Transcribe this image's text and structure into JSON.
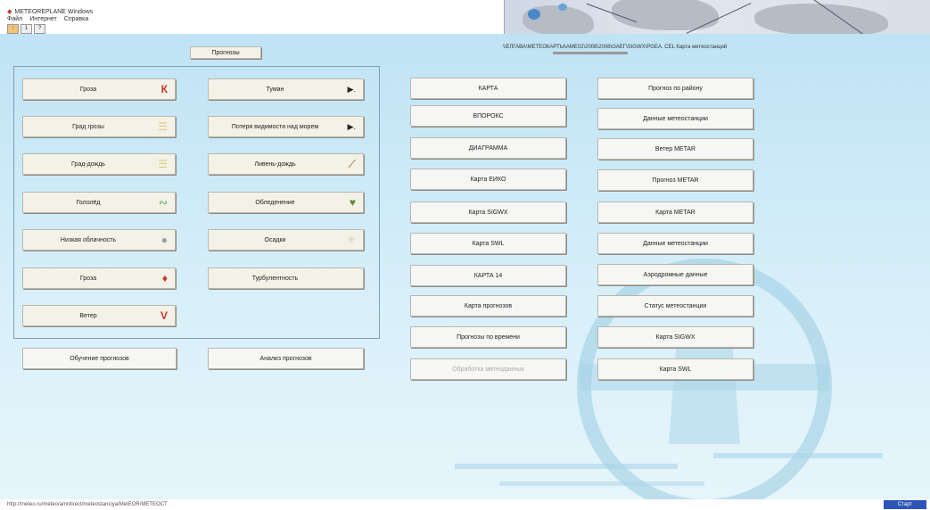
{
  "window": {
    "title": "METEOREPLANE Windows",
    "menu": [
      "Файл",
      "Интернет",
      "Справка"
    ],
    "toolbar": [
      "↑",
      "1",
      "?"
    ]
  },
  "header": {
    "tab_label": "Прогнозы",
    "path_text": "\\\\ЕЛГАВА\\МЕТЕОКАРТЫ\\АМЕ02\\2008\\2008\\ОАЕГ\\SIGWX\\PGEA. CEL Карта метеостанций"
  },
  "left_panel": {
    "buttons": [
      {
        "label": "Гроза",
        "icon": "lightning-flag-icon",
        "glyph": "К",
        "color": "#c0392b"
      },
      {
        "label": "Туман",
        "icon": "fog-icon",
        "glyph": "▶.",
        "color": "#222"
      },
      {
        "label": "Град грозы",
        "icon": "stripes-icon",
        "glyph": "☰",
        "color": "#d9cc80"
      },
      {
        "label": "Потеря видимости над морем",
        "icon": "visibility-arrow-icon",
        "glyph": "▶.",
        "color": "#222"
      },
      {
        "label": "Град-дождь",
        "icon": "stripes-icon",
        "glyph": "☰",
        "color": "#d9cc80"
      },
      {
        "label": "Ливень-дождь",
        "icon": "pen-icon",
        "glyph": "⟋",
        "color": "#7a4a2a"
      },
      {
        "label": "Гололёд",
        "icon": "icing-icon",
        "glyph": "∾",
        "color": "#55aa55"
      },
      {
        "label": "Обледенение",
        "icon": "leaf-icon",
        "glyph": "♥",
        "color": "#5b8f3c"
      },
      {
        "label": "Низкая облачность",
        "icon": "cloud-icon",
        "glyph": "●",
        "color": "#9aa0a6"
      },
      {
        "label": "Осадки",
        "icon": "snowflake-icon",
        "glyph": "✳",
        "color": "#d8d0c4"
      },
      {
        "label": "Гроза",
        "icon": "red-drop-icon",
        "glyph": "♦",
        "color": "#c0392b"
      },
      {
        "label": "Турбулентность",
        "icon": "",
        "glyph": "",
        "color": ""
      },
      {
        "label": "Ветер",
        "icon": "wind-v-icon",
        "glyph": "V",
        "color": "#c0392b"
      }
    ],
    "bottom_buttons": [
      "Обучение прогнозов",
      "Анализ прогнозов"
    ]
  },
  "center_buttons": [
    {
      "label": "КАРТА",
      "disabled": false
    },
    {
      "label": "ВПОРОКС",
      "disabled": false
    },
    {
      "label": "ДИАГРАММА",
      "disabled": false
    },
    {
      "label": "Карта ЕИКО",
      "disabled": false
    },
    {
      "label": "Карта SIGWX",
      "disabled": false
    },
    {
      "label": "Карта SWL",
      "disabled": false
    },
    {
      "label": "КАРТА 14",
      "disabled": false
    },
    {
      "label": "Карта прогнозов",
      "disabled": false
    },
    {
      "label": "Прогнозы по времени",
      "disabled": false
    },
    {
      "label": "Обработка метеоданных",
      "disabled": true
    }
  ],
  "right_buttons": [
    "Прогноз по району",
    "Данные метеостанции",
    "Ветер METAR",
    "Прогноз METAR",
    "Карта METAR",
    "Данные метеостанции",
    "Аэродромные данные",
    "Статус метеостанции",
    "Карта SIGWX",
    "Карта SWL"
  ],
  "status_bar": {
    "text": "http://meteo.ru/meteo/amrdirect/meteostanciya/MetEOR/METEOCT",
    "badge": "Старт"
  },
  "colors": {
    "background_top": "#bfe3f5",
    "button_face": "#f4f1e6",
    "logo_color": "#8ec4dc",
    "badge_blue": "#2d55b8"
  }
}
